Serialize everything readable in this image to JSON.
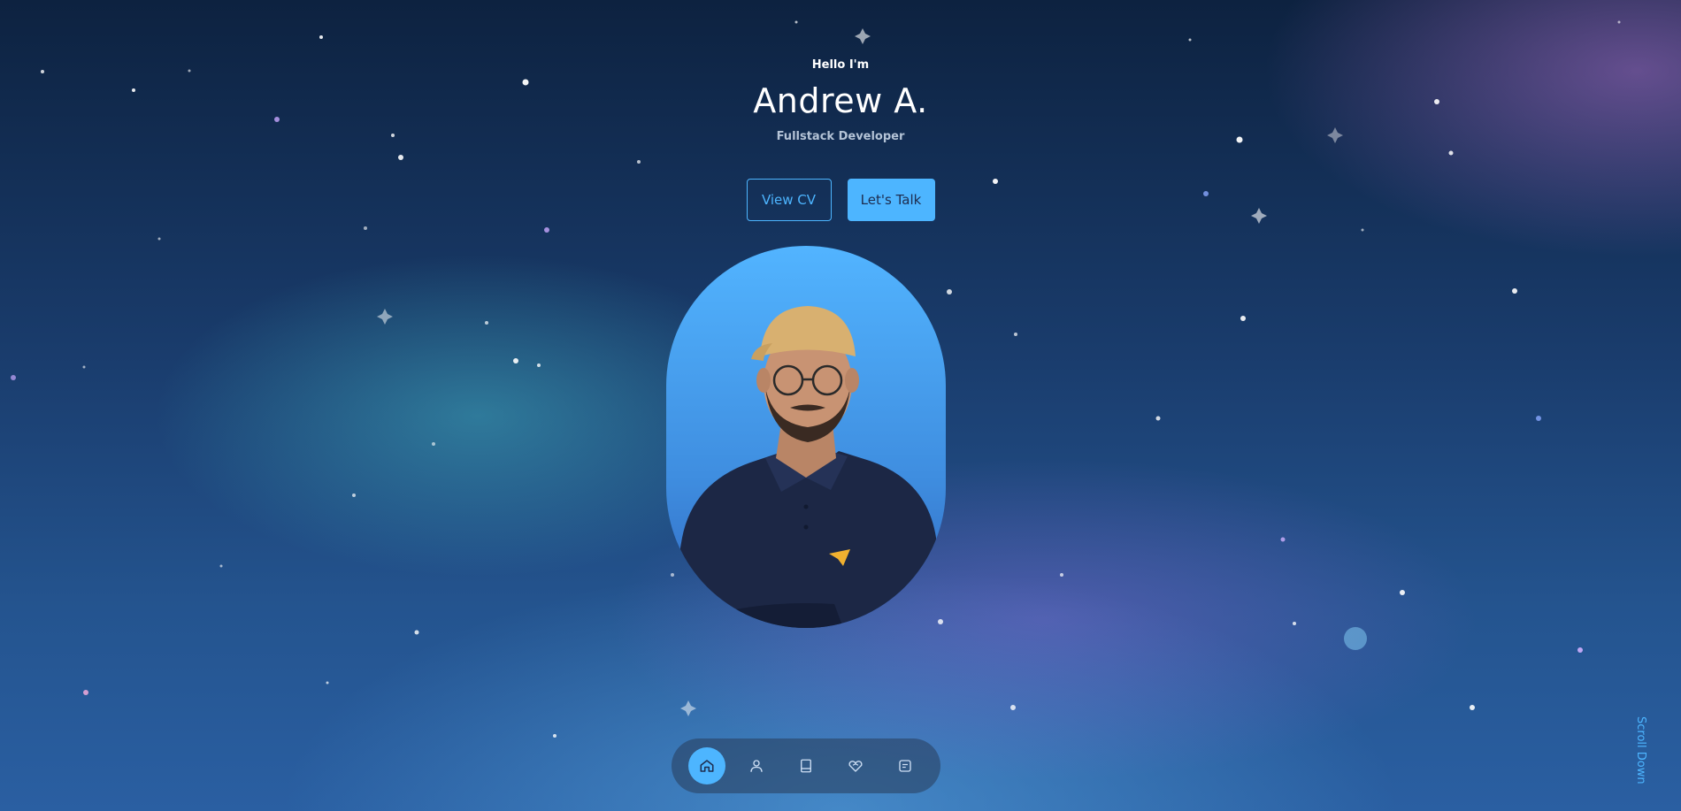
{
  "hero": {
    "greeting": "Hello I'm",
    "name": "Andrew A.",
    "role": "Fullstack Developer"
  },
  "buttons": {
    "view_cv": "View CV",
    "lets_talk": "Let's Talk"
  },
  "portrait": {
    "icon": "person-portrait-photo"
  },
  "nav": {
    "items": [
      {
        "icon": "home-icon",
        "active": true
      },
      {
        "icon": "user-icon",
        "active": false
      },
      {
        "icon": "book-icon",
        "active": false
      },
      {
        "icon": "services-icon",
        "active": false
      },
      {
        "icon": "message-icon",
        "active": false
      }
    ]
  },
  "scroll": {
    "label": "Scroll Down"
  },
  "colors": {
    "accent": "#4db5ff",
    "dark_text": "#1e2d4f",
    "muted_text": "#b4c3d6"
  }
}
